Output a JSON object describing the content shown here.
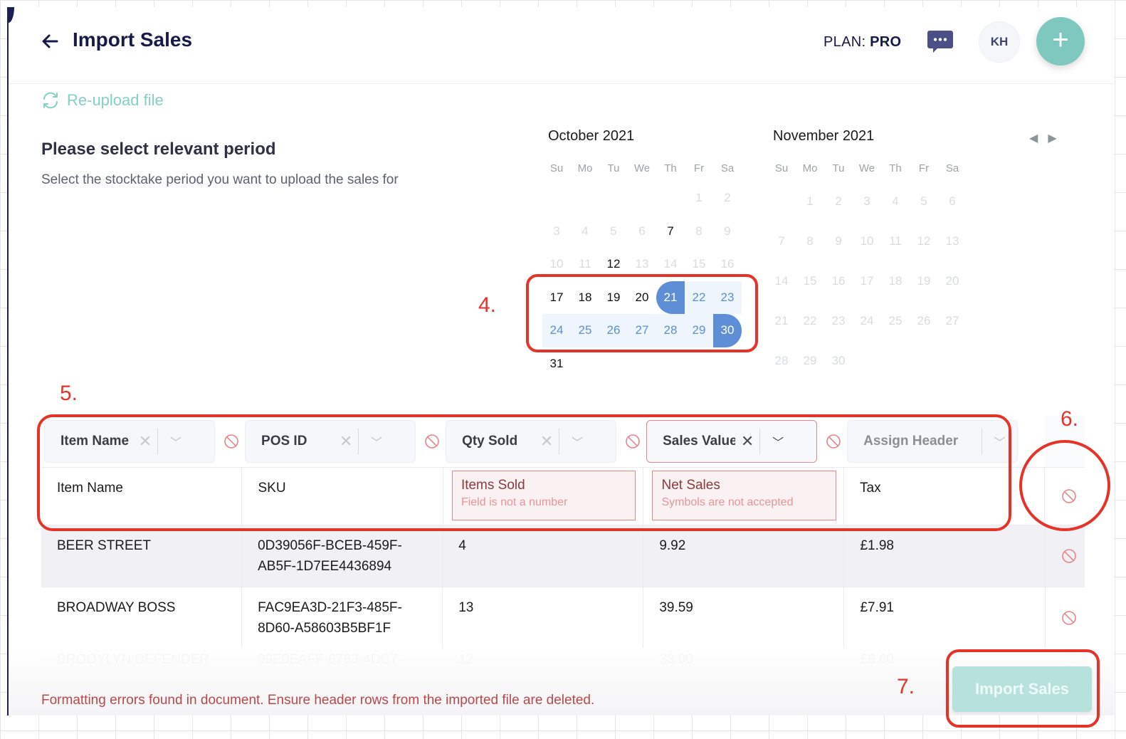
{
  "header": {
    "title": "Import Sales",
    "plan_label": "PLAN:",
    "plan_value": "PRO",
    "avatar_initials": "KH",
    "add_label": "+"
  },
  "reupload_label": "Re-upload file",
  "period": {
    "title": "Please select relevant period",
    "description": "Select the stocktake period you want to upload the sales for"
  },
  "calendars": [
    {
      "title": "October 2021",
      "weekdays": [
        "Su",
        "Mo",
        "Tu",
        "We",
        "Th",
        "Fr",
        "Sa"
      ],
      "leading_blanks": 5,
      "days": 31,
      "available_days": [
        7,
        12,
        17,
        18,
        19,
        20,
        31
      ],
      "range_start": 21,
      "range_end": 30
    },
    {
      "title": "November 2021",
      "weekdays": [
        "Su",
        "Mo",
        "Tu",
        "We",
        "Th",
        "Fr",
        "Sa"
      ],
      "leading_blanks": 1,
      "days": 30,
      "available_days": [],
      "range_start": null,
      "range_end": null
    }
  ],
  "calendar_nav": {
    "prev": "◀",
    "next": "▶"
  },
  "table": {
    "header_selects": [
      {
        "value": "Item Name",
        "error": false,
        "placeholder": false
      },
      {
        "value": "POS ID",
        "error": false,
        "placeholder": false
      },
      {
        "value": "Qty Sold",
        "error": false,
        "placeholder": false
      },
      {
        "value": "Sales Value",
        "error": true,
        "placeholder": false
      },
      {
        "value": "Assign Header",
        "error": false,
        "placeholder": true
      }
    ],
    "file_header_row": [
      {
        "value": "Item Name",
        "error": null
      },
      {
        "value": "SKU",
        "error": null
      },
      {
        "value": "Items Sold",
        "error": "Field is not a number"
      },
      {
        "value": "Net Sales",
        "error": "Symbols are not accepted"
      },
      {
        "value": "Tax",
        "error": null
      }
    ],
    "rows": [
      [
        "BEER STREET",
        "0D39056F-BCEB-459F-AB5F-1D7EE4436894",
        "4",
        "9.92",
        "£1.98"
      ],
      [
        "BROADWAY BOSS",
        "FAC9EA3D-21F3-485F-8D60-A58603B5BF1F",
        "13",
        "39.59",
        "£7.91"
      ],
      [
        "BROOYLYN DEFENDER",
        "99E0EAFF-6763-4DC7-",
        "12",
        "33.00",
        "£6.60"
      ]
    ]
  },
  "footer": {
    "error_message": "Formatting errors found in document. Ensure header rows from the imported file are deleted.",
    "import_button": "Import Sales"
  },
  "annotations": [
    "4.",
    "5.",
    "6.",
    "7."
  ],
  "colors": {
    "brand_navy": "#151a4a",
    "accent_teal": "#7ec8c0",
    "range_blue": "#5e8fd6",
    "error_red": "#b8484c",
    "annotation_red": "#e5332a"
  }
}
